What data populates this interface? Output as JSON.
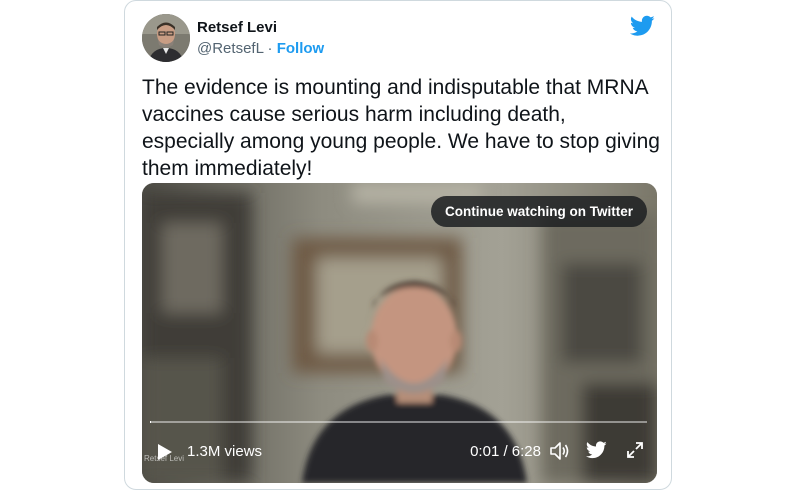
{
  "author": {
    "display_name": "Retsef Levi",
    "handle": "@RetsefL",
    "separator": "·",
    "follow_label": "Follow"
  },
  "icons": {
    "brand": "twitter-bird-icon",
    "play": "play-icon",
    "volume": "volume-icon",
    "share": "twitter-bird-icon",
    "fullscreen": "expand-icon"
  },
  "tweet": {
    "text": "The evidence is mounting and indisputable that MRNA vaccines cause serious harm including death, especially among young people. We have to stop giving them immediately!"
  },
  "video": {
    "continue_label": "Continue watching on Twitter",
    "views": "1.3M views",
    "time": "0:01 / 6:28",
    "watermark": "Retsef Levi",
    "progress": 0.003
  },
  "colors": {
    "accent": "#1d9bf0",
    "text": "#0f1419",
    "muted": "#536471",
    "border": "#cfd9de"
  }
}
